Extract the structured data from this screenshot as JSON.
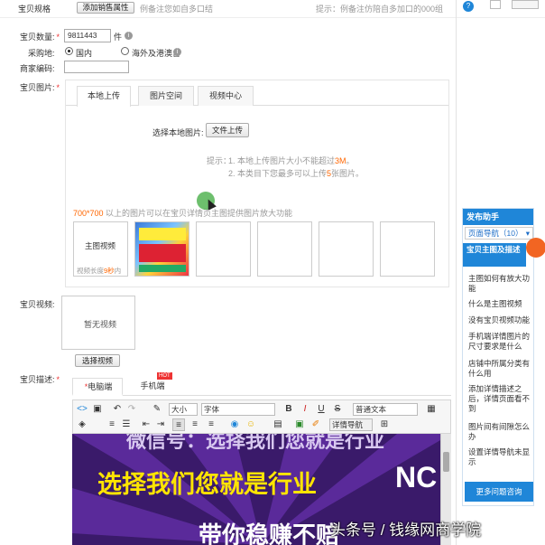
{
  "top": {
    "label_partial": "宝贝规格",
    "add_button": "添加销售属性",
    "hint_left": "例备注您如自多口结",
    "hint_right": "提示：例备注仿陪自多加口的000组"
  },
  "quantity": {
    "label": "宝贝数量:",
    "value": "9811443",
    "unit": "件"
  },
  "origin": {
    "label": "采购地:",
    "options": [
      "国内",
      "海外及港澳台"
    ],
    "selected": "国内"
  },
  "merchant_code": {
    "label": "商家编码:",
    "value": ""
  },
  "images": {
    "label": "宝贝图片:",
    "tabs": [
      "本地上传",
      "图片空间",
      "视频中心"
    ],
    "active_tab": "本地上传",
    "choose_label": "选择本地图片:",
    "upload_button": "文件上传",
    "tip_prefix": "提示：",
    "tip1_a": "1.  本地上传图片大小不能超过",
    "tip1_b": "3M",
    "tip1_c": "。",
    "tip2_a": "2.  本类目下您最多可以上传",
    "tip2_b": "5",
    "tip2_c": "张图片。",
    "note_a": "700*700",
    "note_b": " 以上的图片可以在宝贝详情页主图提供图片放大功能",
    "main_video_title": "主图视频",
    "main_video_len_a": "视频长度",
    "main_video_len_b": "9秒",
    "main_video_len_c": "内"
  },
  "video": {
    "label": "宝贝视频:",
    "empty_text": "暂无视频",
    "select_button": "选择视频"
  },
  "description": {
    "label": "宝贝描述:",
    "tabs": [
      "电脑端",
      "手机端"
    ],
    "active_tab": "电脑端",
    "hot_badge": "HOT",
    "font_size": "大小",
    "font_family": "字体",
    "paragraph": "普通文本",
    "detail_nav": "详情导航",
    "toolbar_bold": "B",
    "toolbar_italic": "I",
    "toolbar_underline": "U",
    "toolbar_strike": "S",
    "banner_line1": "微信号：选择我们您就是行业",
    "banner_line2": "选择我们您就是行业",
    "banner_logo": "NC",
    "banner_line3": "带你稳赚不赔"
  },
  "helper": {
    "title": "发布助手",
    "nav_select": "页面导航（10）",
    "section_title": "宝贝主图及描述",
    "items": [
      "主图如何有放大功能",
      "什么是主图视频",
      "没有宝贝视频功能",
      "手机端详情图片的尺寸要求是什么",
      "店铺中所属分类有什么用",
      "添加详情描述之后，详情页面看不到",
      "图片间有间隙怎么办",
      "设置详情导航未显示"
    ],
    "more_button": "更多问题咨询"
  },
  "watermark": "头条号 / 钱缘网商学院",
  "colors": {
    "accent": "#1f86d8",
    "required": "#e33333",
    "orange": "#ff6600",
    "banner_bg": "#3a1a6a",
    "banner_text": "#ffe500"
  }
}
